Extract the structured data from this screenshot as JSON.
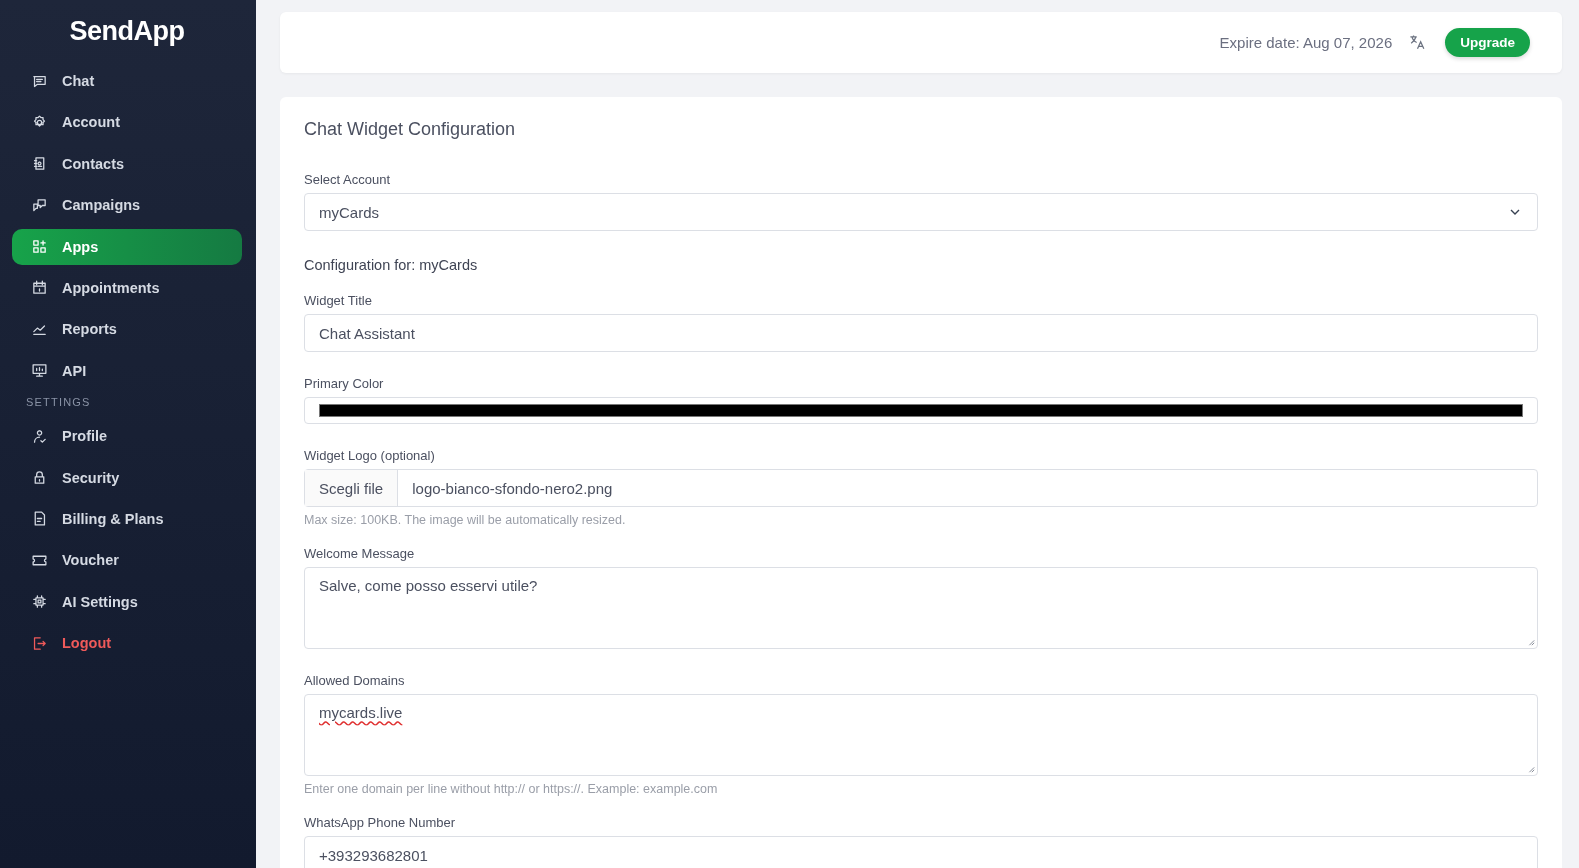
{
  "sidebar": {
    "logo": "SendApp",
    "items": [
      {
        "kind": "item",
        "label": "Chat",
        "selected": false
      },
      {
        "kind": "item",
        "label": "Account",
        "selected": false
      },
      {
        "kind": "item",
        "label": "Contacts",
        "selected": false
      },
      {
        "kind": "item",
        "label": "Campaigns",
        "selected": false
      },
      {
        "kind": "item",
        "label": "Apps",
        "selected": true
      },
      {
        "kind": "item",
        "label": "Appointments",
        "selected": false
      },
      {
        "kind": "item",
        "label": "Reports",
        "selected": false
      },
      {
        "kind": "item",
        "label": "API",
        "selected": false
      },
      {
        "kind": "section",
        "label": "SETTINGS"
      },
      {
        "kind": "item",
        "label": "Profile",
        "selected": false
      },
      {
        "kind": "item",
        "label": "Security",
        "selected": false
      },
      {
        "kind": "item",
        "label": "Billing & Plans",
        "selected": false
      },
      {
        "kind": "item",
        "label": "Voucher",
        "selected": false
      },
      {
        "kind": "item",
        "label": "AI Settings",
        "selected": false
      },
      {
        "kind": "danger",
        "label": "Logout",
        "selected": false
      }
    ]
  },
  "topbar": {
    "expire": "Expire date: Aug 07, 2026",
    "upgrade": "Upgrade"
  },
  "card": {
    "title": "Chat Widget Configuration",
    "account": {
      "label": "Select Account",
      "value": "myCards"
    },
    "config_heading": "Configuration for: myCards",
    "fields": [
      {
        "kind": "text",
        "label": "Widget Title",
        "value": "Chat Assistant"
      },
      {
        "kind": "color",
        "label": "Primary Color",
        "color": "#000000"
      },
      {
        "kind": "file",
        "label": "Widget Logo (optional)",
        "button": "Scegli file",
        "value": "logo-bianco-sfondo-nero2.png",
        "hint": "Max size: 100KB. The image will be automatically resized."
      },
      {
        "kind": "textarea",
        "label": "Welcome Message",
        "value": "Salve, come posso esservi utile?"
      },
      {
        "kind": "textarea",
        "label": "Allowed Domains",
        "value": "mycards.live",
        "misspelled": true,
        "hint": "Enter one domain per line without http:// or https://. Example: example.com"
      },
      {
        "kind": "text",
        "label": "WhatsApp Phone Number",
        "value": "+393293682801"
      }
    ]
  }
}
